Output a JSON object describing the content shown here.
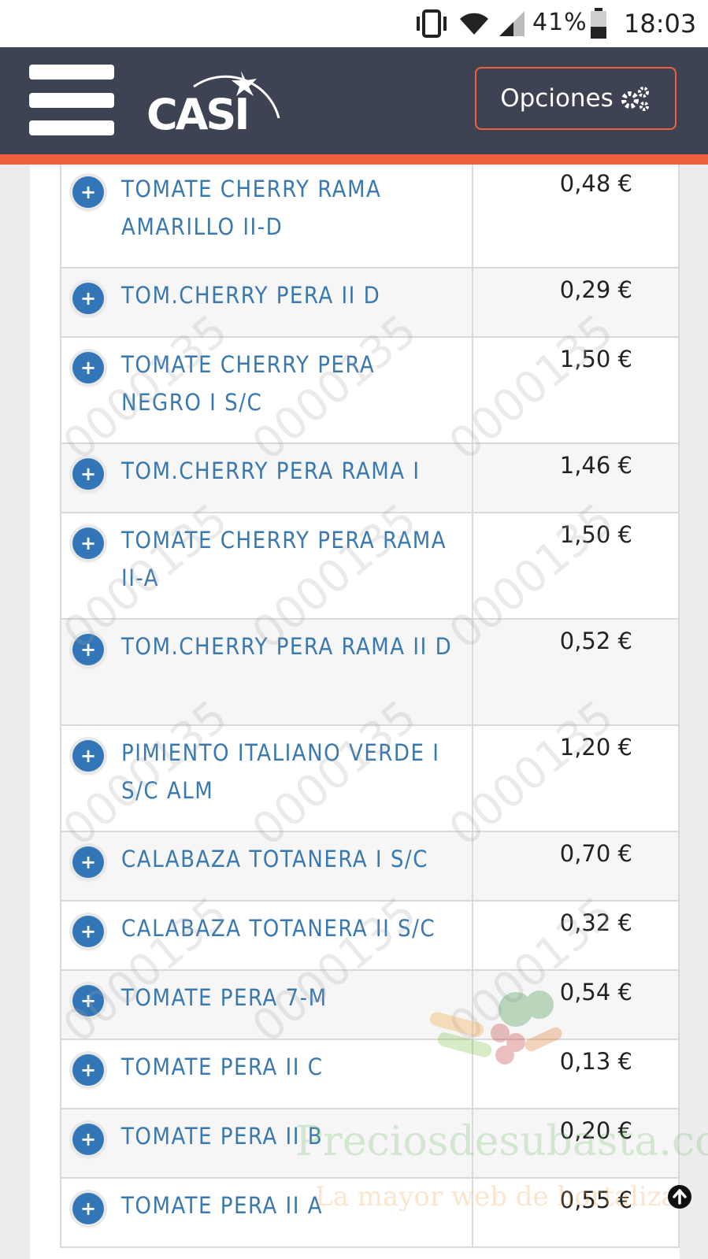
{
  "status_bar": {
    "battery_percent": "41%",
    "time": "18:03"
  },
  "header": {
    "logo_text": "CASI",
    "options_label": "Opciones"
  },
  "products": [
    {
      "name": "TOMATE CHERRY RAMA AMARILLO II-D",
      "price": "0,48 €"
    },
    {
      "name": "TOM.CHERRY PERA II D",
      "price": "0,29 €"
    },
    {
      "name": "TOMATE CHERRY PERA NEGRO I S/C",
      "price": "1,50 €"
    },
    {
      "name": "TOM.CHERRY PERA RAMA I",
      "price": "1,46 €"
    },
    {
      "name": "TOMATE CHERRY PERA RAMA II-A",
      "price": "1,50 €"
    },
    {
      "name": "TOM.CHERRY PERA RAMA II D",
      "price": "0,52 €"
    },
    {
      "name": "PIMIENTO ITALIANO VERDE I S/C ALM",
      "price": "1,20 €"
    },
    {
      "name": "CALABAZA TOTANERA I S/C",
      "price": "0,70 €"
    },
    {
      "name": "CALABAZA TOTANERA II S/C",
      "price": "0,32 €"
    },
    {
      "name": "TOMATE PERA 7-M",
      "price": "0,54 €"
    },
    {
      "name": "TOMATE PERA II C",
      "price": "0,13 €"
    },
    {
      "name": "TOMATE PERA II B",
      "price": "0,20 €"
    },
    {
      "name": "TOMATE PERA II A",
      "price": "0,55 €"
    }
  ],
  "watermark": {
    "site": "Preciosdesubasta.com",
    "tagline": "La mayor web de hortalizas"
  }
}
